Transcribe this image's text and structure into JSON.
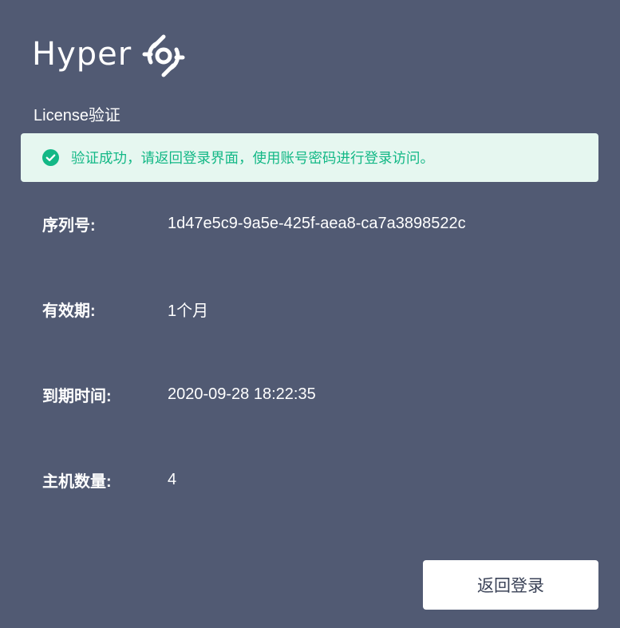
{
  "brand": {
    "name": "Hyper",
    "logo_icon": "hyper-logo-icon"
  },
  "section_title": "License验证",
  "alert": {
    "icon": "check-circle-icon",
    "message": "验证成功，请返回登录界面，使用账号密码进行登录访问。",
    "color": "#13b886",
    "background": "#e6f7f0"
  },
  "license": {
    "serial_label": "序列号:",
    "serial_value": "1d47e5c9-9a5e-425f-aea8-ca7a3898522c",
    "validity_label": "有效期:",
    "validity_value": "1个月",
    "expiry_label": "到期时间:",
    "expiry_value": "2020-09-28 18:22:35",
    "hosts_label": "主机数量:",
    "hosts_value": "4"
  },
  "actions": {
    "back_label": "返回登录"
  },
  "colors": {
    "background": "#515a73",
    "text": "#ffffff"
  }
}
